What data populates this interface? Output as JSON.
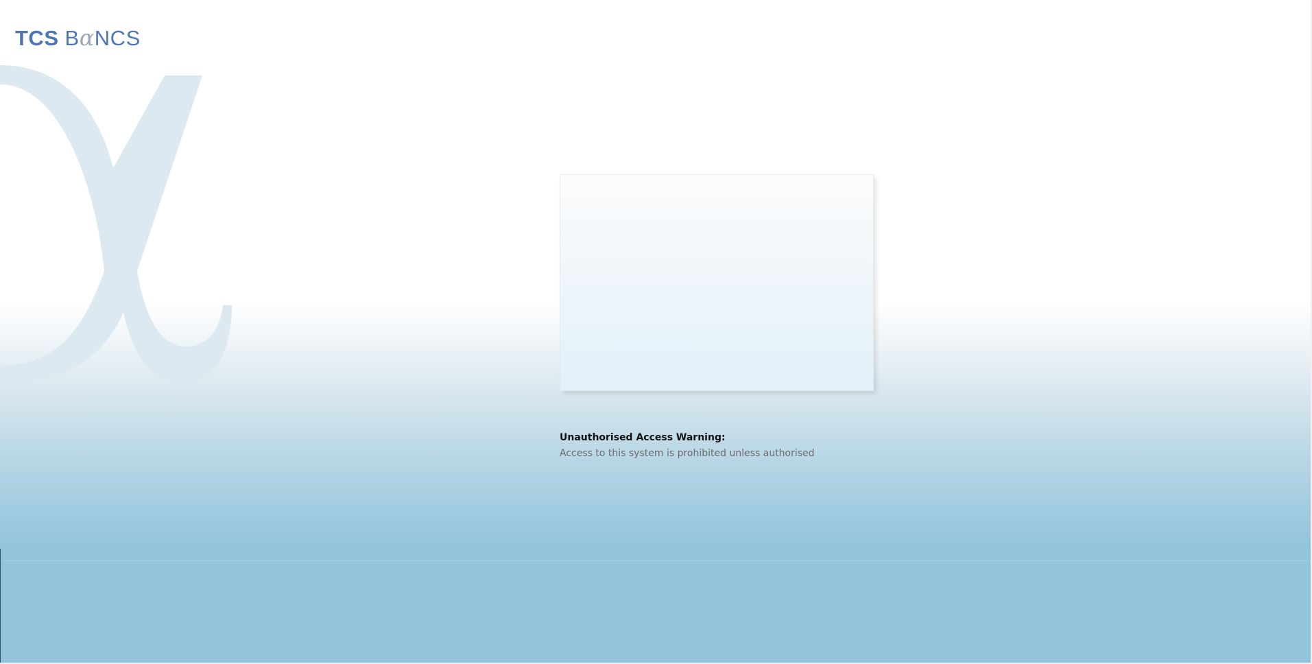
{
  "brand": {
    "logo_part1": "TCS",
    "logo_part2_prefix": "B",
    "logo_part2_glyph": "α",
    "logo_part2_suffix": "NCS",
    "logo_color": "#4d76b8",
    "watermark_icon": "alpha-icon",
    "watermark_color": "#dde9f1"
  },
  "login_frame": {
    "content": ""
  },
  "warning": {
    "title": "Unauthorised Access Warning:",
    "message": "Access to this system is prohibited unless authorised"
  },
  "colors": {
    "background_top": "#ffffff",
    "background_bottom": "#93c4dc"
  }
}
